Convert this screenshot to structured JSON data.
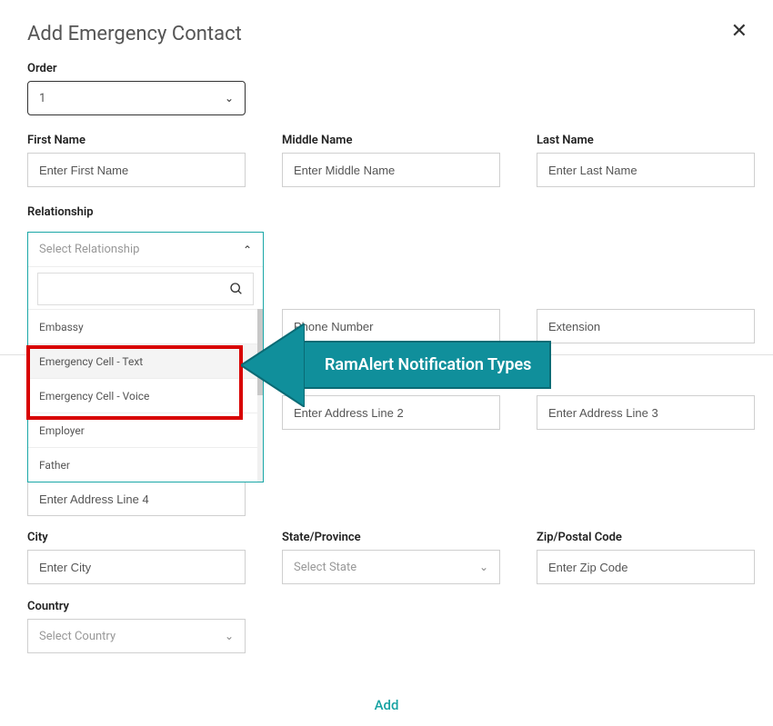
{
  "modal": {
    "title": "Add Emergency Contact",
    "close_label": "✕"
  },
  "order": {
    "label": "Order",
    "value": "1"
  },
  "name": {
    "first_label": "First Name",
    "first_placeholder": "Enter First Name",
    "middle_label": "Middle Name",
    "middle_placeholder": "Enter Middle Name",
    "last_label": "Last Name",
    "last_placeholder": "Enter Last Name"
  },
  "relationship": {
    "label": "Relationship",
    "placeholder": "Select Relationship",
    "options": {
      "0": "Embassy",
      "1": "Emergency Cell - Text",
      "2": "Emergency Cell - Voice",
      "3": "Employer",
      "4": "Father"
    }
  },
  "phone": {
    "number_placeholder": "Phone Number",
    "extension_placeholder": "Extension"
  },
  "address": {
    "line2_placeholder": "Enter Address Line 2",
    "line3_placeholder": "Enter Address Line 3",
    "line4_placeholder": "Enter Address Line 4"
  },
  "city": {
    "label": "City",
    "placeholder": "Enter City"
  },
  "state": {
    "label": "State/Province",
    "placeholder": "Select State"
  },
  "zip": {
    "label": "Zip/Postal Code",
    "placeholder": "Enter Zip Code"
  },
  "country": {
    "label": "Country",
    "placeholder": "Select Country"
  },
  "annotation": {
    "text": "RamAlert Notification Types"
  },
  "actions": {
    "add": "Add"
  }
}
